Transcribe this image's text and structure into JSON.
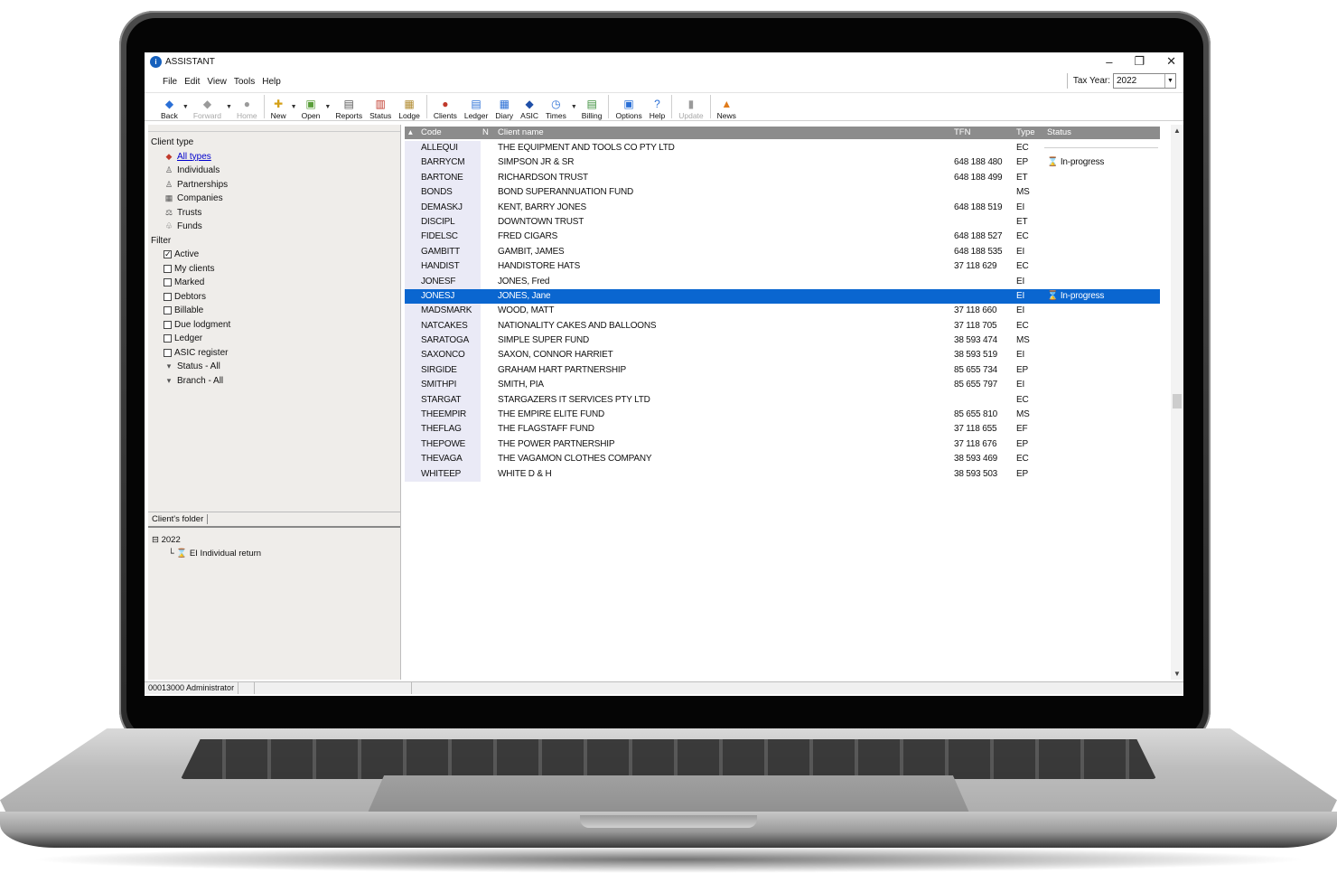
{
  "window": {
    "title": "ASSISTANT"
  },
  "window_controls": {
    "minimize": "–",
    "maximize": "❐",
    "close": "✕"
  },
  "menu": [
    "File",
    "Edit",
    "View",
    "Tools",
    "Help"
  ],
  "tax_year": {
    "label": "Tax Year:",
    "value": "2022"
  },
  "toolbar": [
    {
      "label": "Back",
      "icon": "back-icon",
      "glyph": "◆",
      "color": "#2a6fd6",
      "dropdown": true,
      "disabled": false
    },
    {
      "label": "Forward",
      "icon": "forward-icon",
      "glyph": "◆",
      "color": "#9a9a9a",
      "dropdown": true,
      "disabled": true
    },
    {
      "label": "Home",
      "icon": "home-icon",
      "glyph": "●",
      "color": "#9a9a9a",
      "dropdown": false,
      "disabled": true
    },
    {
      "label": "New",
      "icon": "new-icon",
      "glyph": "✚",
      "color": "#d4a017",
      "dropdown": true,
      "disabled": false
    },
    {
      "label": "Open",
      "icon": "open-icon",
      "glyph": "▣",
      "color": "#5a9e3a",
      "dropdown": true,
      "disabled": false
    },
    {
      "label": "Reports",
      "icon": "reports-icon",
      "glyph": "▤",
      "color": "#555555",
      "dropdown": false,
      "disabled": false
    },
    {
      "label": "Status",
      "icon": "status-icon",
      "glyph": "▥",
      "color": "#c0392b",
      "dropdown": false,
      "disabled": false
    },
    {
      "label": "Lodge",
      "icon": "lodge-icon",
      "glyph": "▦",
      "color": "#b08a2e",
      "dropdown": false,
      "disabled": false
    },
    {
      "label": "Clients",
      "icon": "clients-icon",
      "glyph": "●",
      "color": "#c0392b",
      "dropdown": false,
      "disabled": false
    },
    {
      "label": "Ledger",
      "icon": "ledger-icon",
      "glyph": "▤",
      "color": "#2a6fd6",
      "dropdown": false,
      "disabled": false
    },
    {
      "label": "Diary",
      "icon": "diary-icon",
      "glyph": "▦",
      "color": "#2a6fd6",
      "dropdown": false,
      "disabled": false
    },
    {
      "label": "ASIC",
      "icon": "asic-icon",
      "glyph": "◆",
      "color": "#1f4fa8",
      "dropdown": false,
      "disabled": false
    },
    {
      "label": "Times",
      "icon": "times-icon",
      "glyph": "◷",
      "color": "#2a6fd6",
      "dropdown": true,
      "disabled": false
    },
    {
      "label": "Billing",
      "icon": "billing-icon",
      "glyph": "▤",
      "color": "#3b8f3b",
      "dropdown": false,
      "disabled": false
    },
    {
      "label": "Options",
      "icon": "options-icon",
      "glyph": "▣",
      "color": "#2a6fd6",
      "dropdown": false,
      "disabled": false
    },
    {
      "label": "Help",
      "icon": "help-icon",
      "glyph": "?",
      "color": "#2a6fd6",
      "dropdown": false,
      "disabled": false
    },
    {
      "label": "Update",
      "icon": "update-icon",
      "glyph": "▮",
      "color": "#9a9a9a",
      "dropdown": false,
      "disabled": true
    },
    {
      "label": "News",
      "icon": "news-icon",
      "glyph": "▲",
      "color": "#e07b1a",
      "dropdown": false,
      "disabled": false
    }
  ],
  "left": {
    "client_type_label": "Client type",
    "client_types": [
      {
        "label": "All types",
        "icon": "all-types-icon",
        "glyph": "◆",
        "link": true
      },
      {
        "label": "Individuals",
        "icon": "individual-icon",
        "glyph": "♙",
        "link": false
      },
      {
        "label": "Partnerships",
        "icon": "partnership-icon",
        "glyph": "♙",
        "link": false
      },
      {
        "label": "Companies",
        "icon": "company-icon",
        "glyph": "▦",
        "link": false
      },
      {
        "label": "Trusts",
        "icon": "trust-icon",
        "glyph": "⚖",
        "link": false
      },
      {
        "label": "Funds",
        "icon": "fund-icon",
        "glyph": "♧",
        "link": false
      }
    ],
    "filter_label": "Filter",
    "filters": [
      {
        "label": "Active",
        "checked": true
      },
      {
        "label": "My clients",
        "checked": false
      },
      {
        "label": "Marked",
        "checked": false
      },
      {
        "label": "Debtors",
        "checked": false
      },
      {
        "label": "Billable",
        "checked": false
      },
      {
        "label": "Due lodgment",
        "checked": false
      },
      {
        "label": "Ledger",
        "checked": false
      },
      {
        "label": "ASIC register",
        "checked": false
      }
    ],
    "dropdown_filters": [
      "Status - All",
      "Branch - All"
    ],
    "folder_tab": "Client's folder",
    "folder_year": "2022",
    "folder_item": "EI Individual return"
  },
  "grid": {
    "headers": {
      "code": "Code",
      "n": "N",
      "name": "Client name",
      "tfn": "TFN",
      "type": "Type",
      "status": "Status"
    },
    "rows": [
      {
        "code": "ALLEQUI",
        "name": "THE EQUIPMENT AND TOOLS CO PTY LTD",
        "tfn": "",
        "type": "EC",
        "status": ""
      },
      {
        "code": "BARRYCM",
        "name": "SIMPSON JR & SR",
        "tfn": "648 188 480",
        "type": "EP",
        "status": "In-progress"
      },
      {
        "code": "BARTONE",
        "name": "RICHARDSON TRUST",
        "tfn": "648 188 499",
        "type": "ET",
        "status": ""
      },
      {
        "code": "BONDS",
        "name": "BOND SUPERANNUATION FUND",
        "tfn": "",
        "type": "MS",
        "status": ""
      },
      {
        "code": "DEMASKJ",
        "name": "KENT, BARRY JONES",
        "tfn": "648 188 519",
        "type": "EI",
        "status": ""
      },
      {
        "code": "DISCIPL",
        "name": "DOWNTOWN TRUST",
        "tfn": "",
        "type": "ET",
        "status": ""
      },
      {
        "code": "FIDELSC",
        "name": "FRED CIGARS",
        "tfn": "648 188 527",
        "type": "EC",
        "status": ""
      },
      {
        "code": "GAMBITT",
        "name": "GAMBIT, JAMES",
        "tfn": "648 188 535",
        "type": "EI",
        "status": ""
      },
      {
        "code": "HANDIST",
        "name": "HANDISTORE HATS",
        "tfn": "37 118 629",
        "type": "EC",
        "status": ""
      },
      {
        "code": "JONESF",
        "name": "JONES, Fred",
        "tfn": "",
        "type": "EI",
        "status": ""
      },
      {
        "code": "JONESJ",
        "name": "JONES, Jane",
        "tfn": "",
        "type": "EI",
        "status": "In-progress",
        "selected": true
      },
      {
        "code": "MADSMARK",
        "name": "WOOD, MATT",
        "tfn": "37 118 660",
        "type": "EI",
        "status": ""
      },
      {
        "code": "NATCAKES",
        "name": "NATIONALITY CAKES AND BALLOONS",
        "tfn": "37 118 705",
        "type": "EC",
        "status": ""
      },
      {
        "code": "SARATOGA",
        "name": "SIMPLE SUPER FUND",
        "tfn": "38 593 474",
        "type": "MS",
        "status": ""
      },
      {
        "code": "SAXONCO",
        "name": "SAXON, CONNOR HARRIET",
        "tfn": "38 593 519",
        "type": "EI",
        "status": ""
      },
      {
        "code": "SIRGIDE",
        "name": "GRAHAM HART PARTNERSHIP",
        "tfn": "85 655 734",
        "type": "EP",
        "status": ""
      },
      {
        "code": "SMITHPI",
        "name": "SMITH, PIA",
        "tfn": "85 655 797",
        "type": "EI",
        "status": ""
      },
      {
        "code": "STARGAT",
        "name": "STARGAZERS IT SERVICES PTY LTD",
        "tfn": "",
        "type": "EC",
        "status": ""
      },
      {
        "code": "THEEMPIR",
        "name": "THE EMPIRE ELITE FUND",
        "tfn": "85 655 810",
        "type": "MS",
        "status": ""
      },
      {
        "code": "THEFLAG",
        "name": "THE FLAGSTAFF FUND",
        "tfn": "37 118 655",
        "type": "EF",
        "status": ""
      },
      {
        "code": "THEPOWE",
        "name": "THE POWER PARTNERSHIP",
        "tfn": "37 118 676",
        "type": "EP",
        "status": ""
      },
      {
        "code": "THEVAGA",
        "name": "THE VAGAMON CLOTHES COMPANY",
        "tfn": "38 593 469",
        "type": "EC",
        "status": ""
      },
      {
        "code": "WHITEEP",
        "name": "WHITE D & H",
        "tfn": "38 593 503",
        "type": "EP",
        "status": ""
      }
    ]
  },
  "statusbar": {
    "user": "00013000 Administrator"
  },
  "colors": {
    "selection": "#0a66d0",
    "header": "#8c8c8c",
    "panel": "#efedea",
    "link": "#0000cc"
  }
}
